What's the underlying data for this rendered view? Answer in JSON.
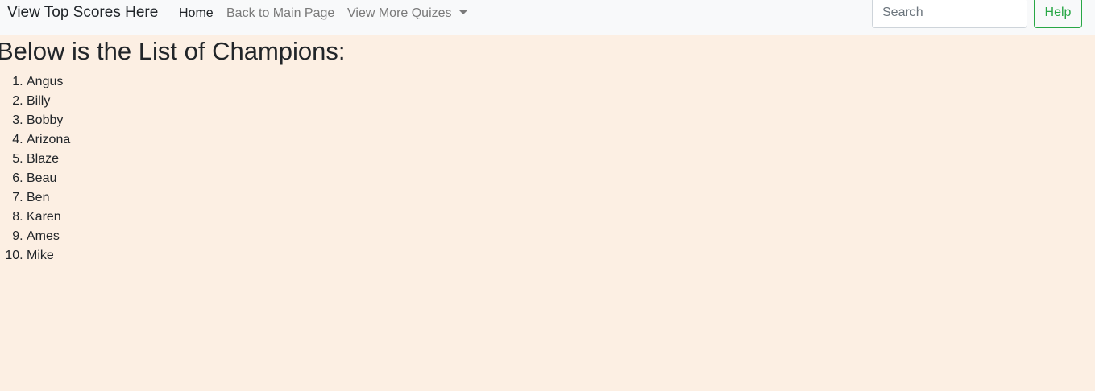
{
  "navbar": {
    "brand": "View Top Scores Here",
    "links": [
      {
        "label": "Home"
      },
      {
        "label": "Back to Main Page"
      },
      {
        "label": "View More Quizes"
      }
    ],
    "search": {
      "placeholder": "Search",
      "value": ""
    },
    "help_label": "Help"
  },
  "main": {
    "title": "Below is the List of Champions:",
    "champions": [
      "Angus",
      "Billy",
      "Bobby",
      "Arizona",
      "Blaze",
      "Beau",
      "Ben",
      "Karen",
      "Ames",
      "Mike"
    ]
  },
  "colors": {
    "page_background": "#fcefe3",
    "navbar_background": "#f8f9fa",
    "accent_green": "#28a745"
  }
}
